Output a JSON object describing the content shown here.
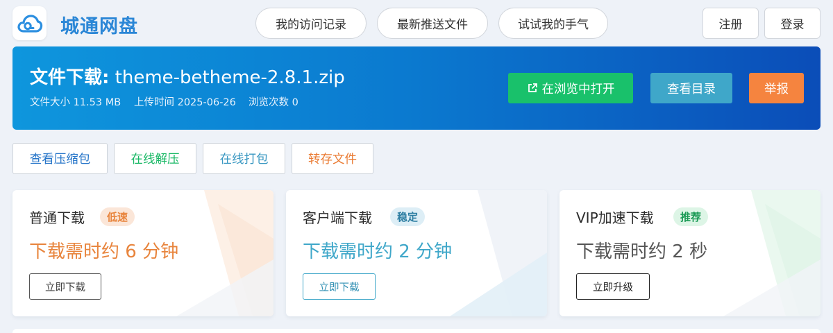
{
  "header": {
    "brand": "城通网盘",
    "nav": [
      "我的访问记录",
      "最新推送文件",
      "试试我的手气"
    ],
    "register": "注册",
    "login": "登录"
  },
  "file": {
    "title_label": "文件下载:",
    "file_name": "theme-betheme-2.8.1.zip",
    "size_label": "文件大小",
    "size": "11.53 MB",
    "upload_label": "上传时间",
    "upload_time": "2025-06-26",
    "views_label": "浏览次数",
    "views": "0"
  },
  "actions": {
    "open_in_browser": "在浏览中打开",
    "view_catalog": "查看目录",
    "report": "举报"
  },
  "tools": [
    "查看压缩包",
    "在线解压",
    "在线打包",
    "转存文件"
  ],
  "cards": [
    {
      "title": "普通下载",
      "badge": "低速",
      "time": "下载需时约 6 分钟",
      "button": "立即下载"
    },
    {
      "title": "客户端下载",
      "badge": "稳定",
      "time": "下载需时约 2 分钟",
      "button": "立即下载"
    },
    {
      "title": "VIP加速下载",
      "badge": "推荐",
      "time": "下载需时约 2 秒",
      "button": "立即升级"
    }
  ],
  "colors": {
    "brand": "#2a86d6",
    "green": "#19c16b",
    "teal": "#3fa7c9",
    "orange": "#f5843f",
    "slow": "#e8843c",
    "client": "#3fa7c9"
  }
}
